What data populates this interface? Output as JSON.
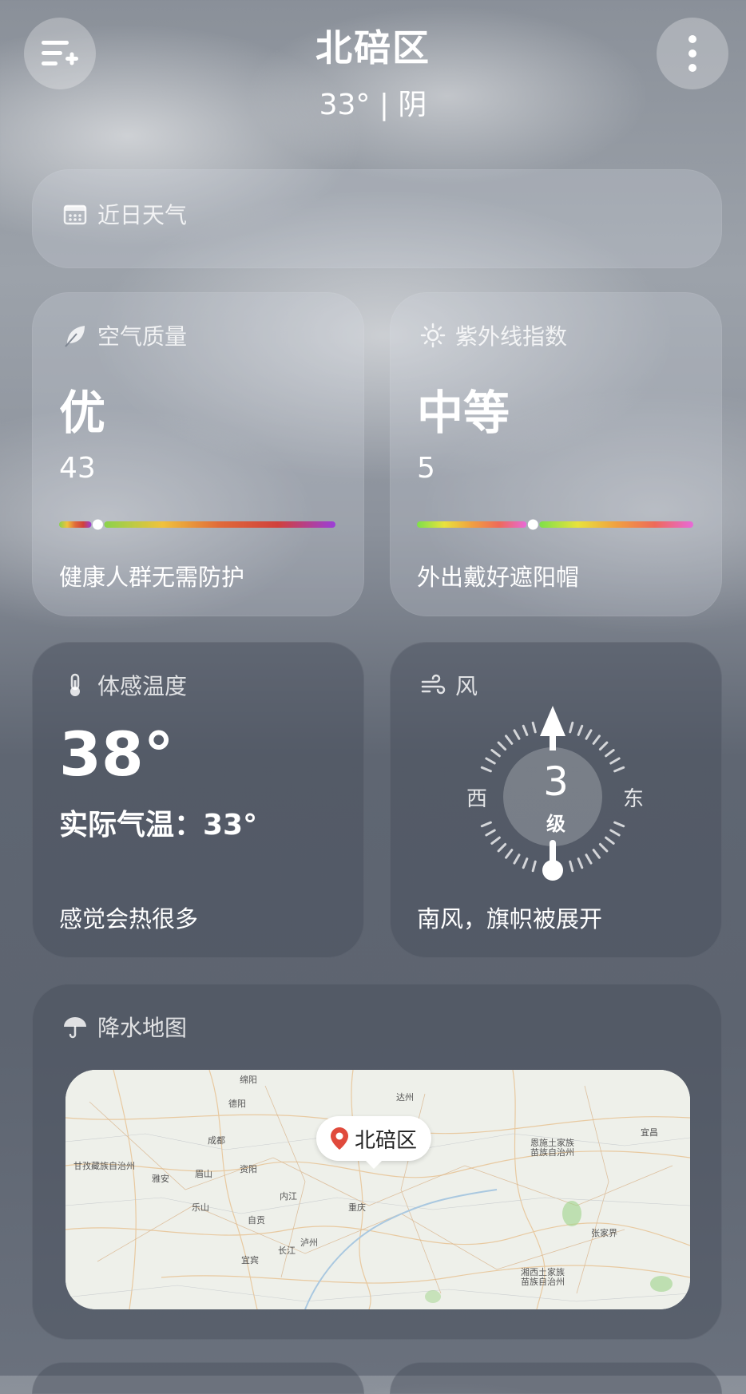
{
  "header": {
    "location": "北碚区",
    "summary": "33° | 阴",
    "menu_icon": "list-add-icon",
    "more_icon": "more-vertical-icon"
  },
  "recent_weather": {
    "label": "近日天气",
    "icon": "calendar-icon"
  },
  "air_quality": {
    "label": "空气质量",
    "icon": "leaf-icon",
    "level": "优",
    "value": "43",
    "advice": "健康人群无需防护",
    "gauge_position": 0.14,
    "colors": [
      "#8bd24c",
      "#f0c23c",
      "#e06a3a",
      "#d0413c",
      "#9b3fd8"
    ]
  },
  "uv": {
    "label": "紫外线指数",
    "icon": "sun-icon",
    "level": "中等",
    "value": "5",
    "advice": "外出戴好遮阳帽",
    "gauge_position": 0.42,
    "colors": [
      "#7ee04a",
      "#e8e23c",
      "#f0a040",
      "#ee6a5a",
      "#e86ad8"
    ]
  },
  "feels_like": {
    "label": "体感温度",
    "icon": "thermometer-icon",
    "value": "38°",
    "actual": "实际气温：33°",
    "note": "感觉会热很多"
  },
  "wind": {
    "label": "风",
    "icon": "wind-icon",
    "level_number": "3",
    "level_unit": "级",
    "west": "西",
    "east": "东",
    "description": "南风，旗帜被展开"
  },
  "precip_map": {
    "label": "降水地图",
    "icon": "umbrella-icon",
    "pin_label": "北碚区",
    "cities": [
      "绵阳",
      "德阳",
      "成都",
      "达州",
      "眉山",
      "资阳",
      "雅安",
      "内江",
      "乐山",
      "自贡",
      "泸州",
      "重庆",
      "宜宾",
      "长江",
      "宜昌",
      "张家界",
      "恩施土家族苗族自治州",
      "湘西土家族苗族自治州",
      "甘孜藏族自治州"
    ]
  }
}
